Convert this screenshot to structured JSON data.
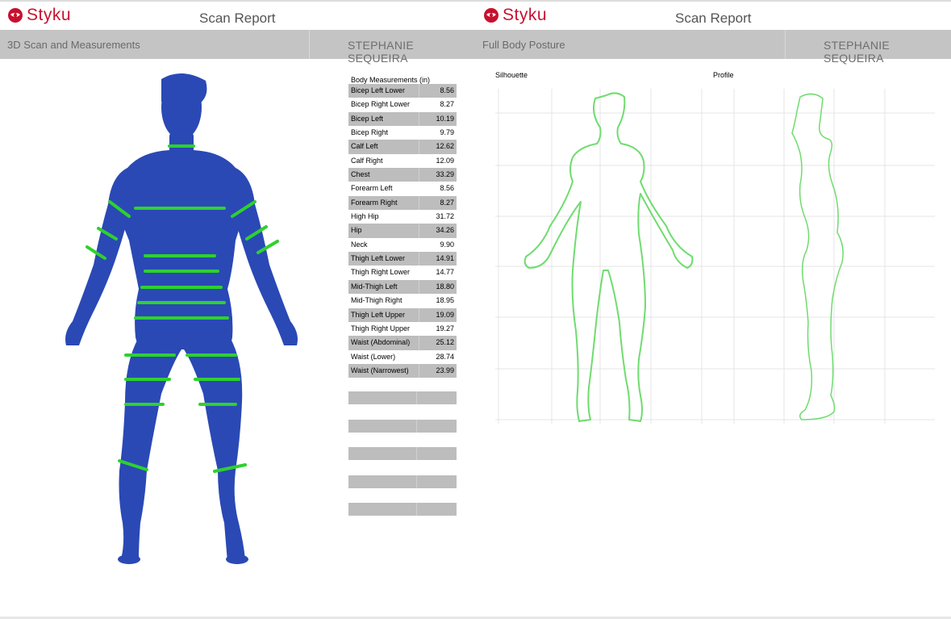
{
  "brand": {
    "name": "Styku",
    "color": "#c8102e"
  },
  "left_panel": {
    "report_title": "Scan Report",
    "section_title": "3D Scan and Measurements",
    "customer_name": "STEPHANIE SEQUEIRA",
    "body_model_color": "#2a49b5",
    "measure_line_color": "#2ed12e",
    "measurements_header": "Body Measurements (in)",
    "measurements": [
      {
        "label": "Bicep Left Lower",
        "value": "8.56"
      },
      {
        "label": "Bicep Right Lower",
        "value": "8.27"
      },
      {
        "label": "Bicep Left",
        "value": "10.19"
      },
      {
        "label": "Bicep Right",
        "value": "9.79"
      },
      {
        "label": "Calf Left",
        "value": "12.62"
      },
      {
        "label": "Calf Right",
        "value": "12.09"
      },
      {
        "label": "Chest",
        "value": "33.29"
      },
      {
        "label": "Forearm Left",
        "value": "8.56"
      },
      {
        "label": "Forearm Right",
        "value": "8.27"
      },
      {
        "label": "High Hip",
        "value": "31.72"
      },
      {
        "label": "Hip",
        "value": "34.26"
      },
      {
        "label": "Neck",
        "value": "9.90"
      },
      {
        "label": "Thigh Left Lower",
        "value": "14.91"
      },
      {
        "label": "Thigh Right Lower",
        "value": "14.77"
      },
      {
        "label": "Mid-Thigh Left",
        "value": "18.80"
      },
      {
        "label": "Mid-Thigh Right",
        "value": "18.95"
      },
      {
        "label": "Thigh Left Upper",
        "value": "19.09"
      },
      {
        "label": "Thigh Right Upper",
        "value": "19.27"
      },
      {
        "label": "Waist (Abdominal)",
        "value": "25.12"
      },
      {
        "label": "Waist (Lower)",
        "value": "28.74"
      },
      {
        "label": "Waist (Narrowest)",
        "value": "23.99"
      }
    ]
  },
  "right_panel": {
    "report_title": "Scan Report",
    "section_title": "Full Body Posture",
    "customer_name": "STEPHANIE SEQUEIRA",
    "silhouette_label": "Silhouette",
    "profile_label": "Profile",
    "outline_color": "#6fdc6f",
    "grid_color": "#e4e4e4"
  }
}
